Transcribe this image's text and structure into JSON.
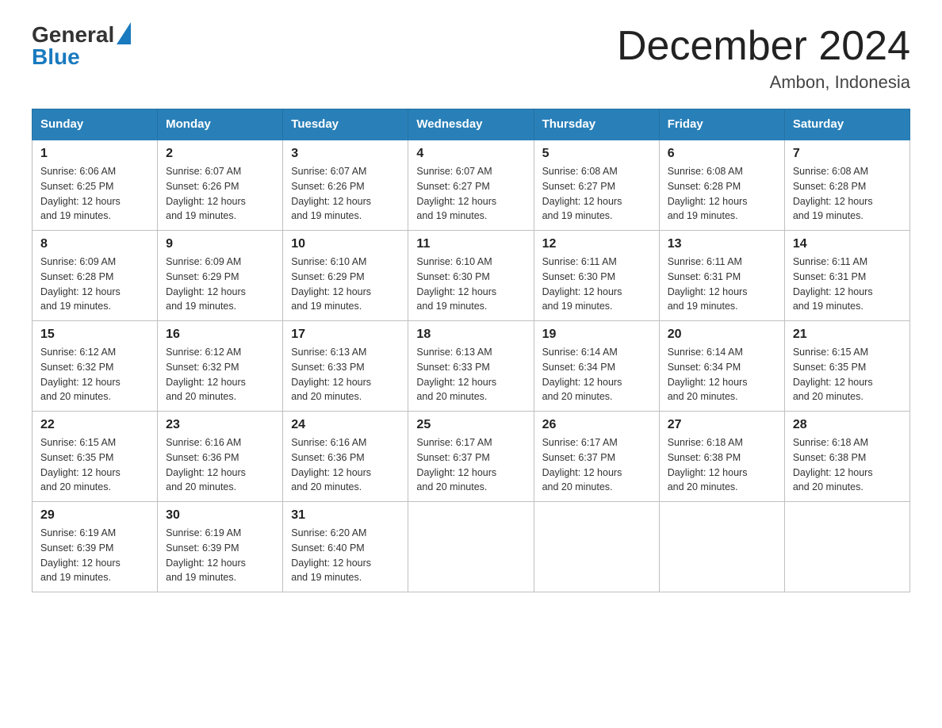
{
  "header": {
    "logo_text_general": "General",
    "logo_text_blue": "Blue",
    "title": "December 2024",
    "subtitle": "Ambon, Indonesia"
  },
  "days_of_week": [
    "Sunday",
    "Monday",
    "Tuesday",
    "Wednesday",
    "Thursday",
    "Friday",
    "Saturday"
  ],
  "weeks": [
    [
      {
        "day": "1",
        "sunrise": "6:06 AM",
        "sunset": "6:25 PM",
        "daylight": "12 hours and 19 minutes."
      },
      {
        "day": "2",
        "sunrise": "6:07 AM",
        "sunset": "6:26 PM",
        "daylight": "12 hours and 19 minutes."
      },
      {
        "day": "3",
        "sunrise": "6:07 AM",
        "sunset": "6:26 PM",
        "daylight": "12 hours and 19 minutes."
      },
      {
        "day": "4",
        "sunrise": "6:07 AM",
        "sunset": "6:27 PM",
        "daylight": "12 hours and 19 minutes."
      },
      {
        "day": "5",
        "sunrise": "6:08 AM",
        "sunset": "6:27 PM",
        "daylight": "12 hours and 19 minutes."
      },
      {
        "day": "6",
        "sunrise": "6:08 AM",
        "sunset": "6:28 PM",
        "daylight": "12 hours and 19 minutes."
      },
      {
        "day": "7",
        "sunrise": "6:08 AM",
        "sunset": "6:28 PM",
        "daylight": "12 hours and 19 minutes."
      }
    ],
    [
      {
        "day": "8",
        "sunrise": "6:09 AM",
        "sunset": "6:28 PM",
        "daylight": "12 hours and 19 minutes."
      },
      {
        "day": "9",
        "sunrise": "6:09 AM",
        "sunset": "6:29 PM",
        "daylight": "12 hours and 19 minutes."
      },
      {
        "day": "10",
        "sunrise": "6:10 AM",
        "sunset": "6:29 PM",
        "daylight": "12 hours and 19 minutes."
      },
      {
        "day": "11",
        "sunrise": "6:10 AM",
        "sunset": "6:30 PM",
        "daylight": "12 hours and 19 minutes."
      },
      {
        "day": "12",
        "sunrise": "6:11 AM",
        "sunset": "6:30 PM",
        "daylight": "12 hours and 19 minutes."
      },
      {
        "day": "13",
        "sunrise": "6:11 AM",
        "sunset": "6:31 PM",
        "daylight": "12 hours and 19 minutes."
      },
      {
        "day": "14",
        "sunrise": "6:11 AM",
        "sunset": "6:31 PM",
        "daylight": "12 hours and 19 minutes."
      }
    ],
    [
      {
        "day": "15",
        "sunrise": "6:12 AM",
        "sunset": "6:32 PM",
        "daylight": "12 hours and 20 minutes."
      },
      {
        "day": "16",
        "sunrise": "6:12 AM",
        "sunset": "6:32 PM",
        "daylight": "12 hours and 20 minutes."
      },
      {
        "day": "17",
        "sunrise": "6:13 AM",
        "sunset": "6:33 PM",
        "daylight": "12 hours and 20 minutes."
      },
      {
        "day": "18",
        "sunrise": "6:13 AM",
        "sunset": "6:33 PM",
        "daylight": "12 hours and 20 minutes."
      },
      {
        "day": "19",
        "sunrise": "6:14 AM",
        "sunset": "6:34 PM",
        "daylight": "12 hours and 20 minutes."
      },
      {
        "day": "20",
        "sunrise": "6:14 AM",
        "sunset": "6:34 PM",
        "daylight": "12 hours and 20 minutes."
      },
      {
        "day": "21",
        "sunrise": "6:15 AM",
        "sunset": "6:35 PM",
        "daylight": "12 hours and 20 minutes."
      }
    ],
    [
      {
        "day": "22",
        "sunrise": "6:15 AM",
        "sunset": "6:35 PM",
        "daylight": "12 hours and 20 minutes."
      },
      {
        "day": "23",
        "sunrise": "6:16 AM",
        "sunset": "6:36 PM",
        "daylight": "12 hours and 20 minutes."
      },
      {
        "day": "24",
        "sunrise": "6:16 AM",
        "sunset": "6:36 PM",
        "daylight": "12 hours and 20 minutes."
      },
      {
        "day": "25",
        "sunrise": "6:17 AM",
        "sunset": "6:37 PM",
        "daylight": "12 hours and 20 minutes."
      },
      {
        "day": "26",
        "sunrise": "6:17 AM",
        "sunset": "6:37 PM",
        "daylight": "12 hours and 20 minutes."
      },
      {
        "day": "27",
        "sunrise": "6:18 AM",
        "sunset": "6:38 PM",
        "daylight": "12 hours and 20 minutes."
      },
      {
        "day": "28",
        "sunrise": "6:18 AM",
        "sunset": "6:38 PM",
        "daylight": "12 hours and 20 minutes."
      }
    ],
    [
      {
        "day": "29",
        "sunrise": "6:19 AM",
        "sunset": "6:39 PM",
        "daylight": "12 hours and 19 minutes."
      },
      {
        "day": "30",
        "sunrise": "6:19 AM",
        "sunset": "6:39 PM",
        "daylight": "12 hours and 19 minutes."
      },
      {
        "day": "31",
        "sunrise": "6:20 AM",
        "sunset": "6:40 PM",
        "daylight": "12 hours and 19 minutes."
      },
      null,
      null,
      null,
      null
    ]
  ],
  "labels": {
    "sunrise": "Sunrise: ",
    "sunset": "Sunset: ",
    "daylight": "Daylight: "
  }
}
